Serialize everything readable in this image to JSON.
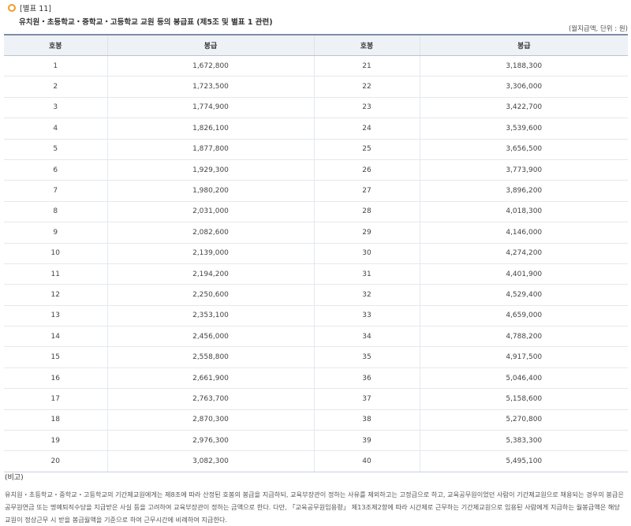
{
  "header": {
    "tag": "[별표 11]",
    "title": "유치원・초등학교・중학교・고등학교 교원 등의 봉급표 (제5조 및 별표 1 관련)",
    "unit": "(월지급액, 단위 : 원)"
  },
  "table": {
    "headers": [
      "호봉",
      "봉급",
      "호봉",
      "봉급"
    ],
    "rows": [
      [
        "1",
        "1,672,800",
        "21",
        "3,188,300"
      ],
      [
        "2",
        "1,723,500",
        "22",
        "3,306,000"
      ],
      [
        "3",
        "1,774,900",
        "23",
        "3,422,700"
      ],
      [
        "4",
        "1,826,100",
        "24",
        "3,539,600"
      ],
      [
        "5",
        "1,877,800",
        "25",
        "3,656,500"
      ],
      [
        "6",
        "1,929,300",
        "26",
        "3,773,900"
      ],
      [
        "7",
        "1,980,200",
        "27",
        "3,896,200"
      ],
      [
        "8",
        "2,031,000",
        "28",
        "4,018,300"
      ],
      [
        "9",
        "2,082,600",
        "29",
        "4,146,000"
      ],
      [
        "10",
        "2,139,000",
        "30",
        "4,274,200"
      ],
      [
        "11",
        "2,194,200",
        "31",
        "4,401,900"
      ],
      [
        "12",
        "2,250,600",
        "32",
        "4,529,400"
      ],
      [
        "13",
        "2,353,100",
        "33",
        "4,659,000"
      ],
      [
        "14",
        "2,456,000",
        "34",
        "4,788,200"
      ],
      [
        "15",
        "2,558,800",
        "35",
        "4,917,500"
      ],
      [
        "16",
        "2,661,900",
        "36",
        "5,046,400"
      ],
      [
        "17",
        "2,763,700",
        "37",
        "5,158,600"
      ],
      [
        "18",
        "2,870,300",
        "38",
        "5,270,800"
      ],
      [
        "19",
        "2,976,300",
        "39",
        "5,383,300"
      ],
      [
        "20",
        "3,082,300",
        "40",
        "5,495,100"
      ]
    ]
  },
  "note": {
    "title": "(비고)",
    "text": "유치원・초등학교・중학교・고등학교의 기간제교원에게는 제8조에 따라 산정된 호봉의 봉급을 지급하되, 교육부장관이 정하는 사유를 제외하고는 고정급으로 하고, 교육공무원이었던 사람이 기간제교원으로 채용되는 경우의 봉급은 공무원연금 또는 명예퇴직수당을 지급받은 사실 등을 고려하여 교육부장관이 정하는 금액으로 한다. 다만, 「교육공무원임용령」 제13조제2항에 따라 시간제로 근무하는 기간제교원으로 임용된 사람에게 지급하는 월봉급액은 해당 교원이 정상근무 시 받을 봉급월액을 기준으로 하여 근무시간에 비례하여 지급한다."
  }
}
